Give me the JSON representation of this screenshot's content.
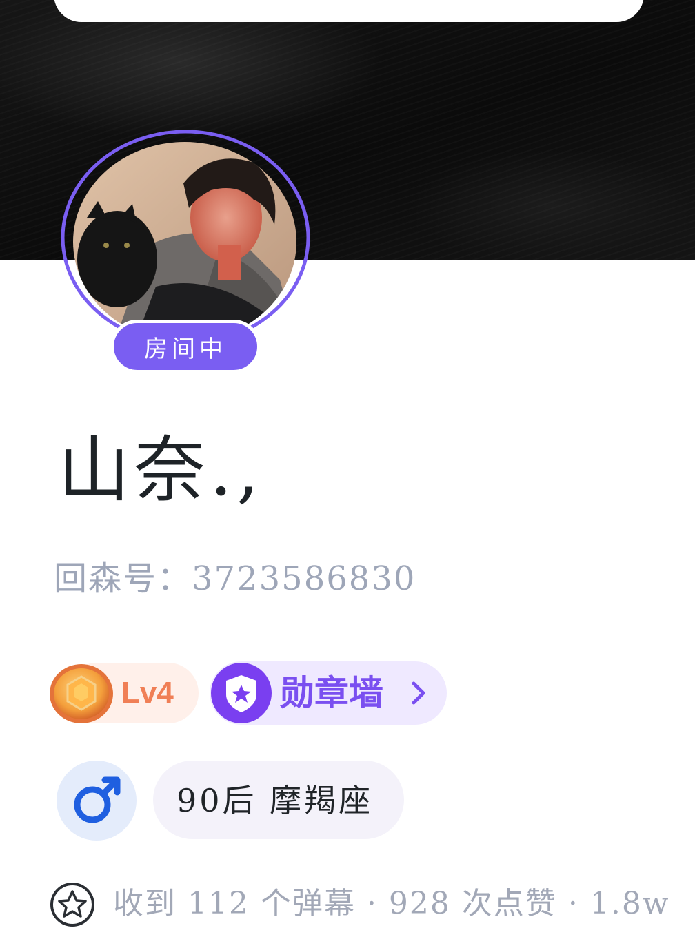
{
  "profile": {
    "room_status": "房间中",
    "nickname": "山奈.,",
    "user_id": "回森号：3723586830"
  },
  "badges": {
    "level": "Lv4",
    "medal_wall": "勋章墙",
    "chevron_icon": "chevron-right-icon",
    "level_icon": "honeycomb-level-icon",
    "medal_icon": "shield-star-icon"
  },
  "info": {
    "gender_icon": "male-icon",
    "tags": "90后 摩羯座"
  },
  "stats": {
    "icon": "flower-icon",
    "text": "收到 112 个弹幕 · 928 次点赞 · 1.8w"
  },
  "colors": {
    "accent_purple": "#7a5ef2",
    "level_orange": "#f07f56",
    "male_blue": "#1f5fe0",
    "muted_text": "#9ea6b8"
  }
}
